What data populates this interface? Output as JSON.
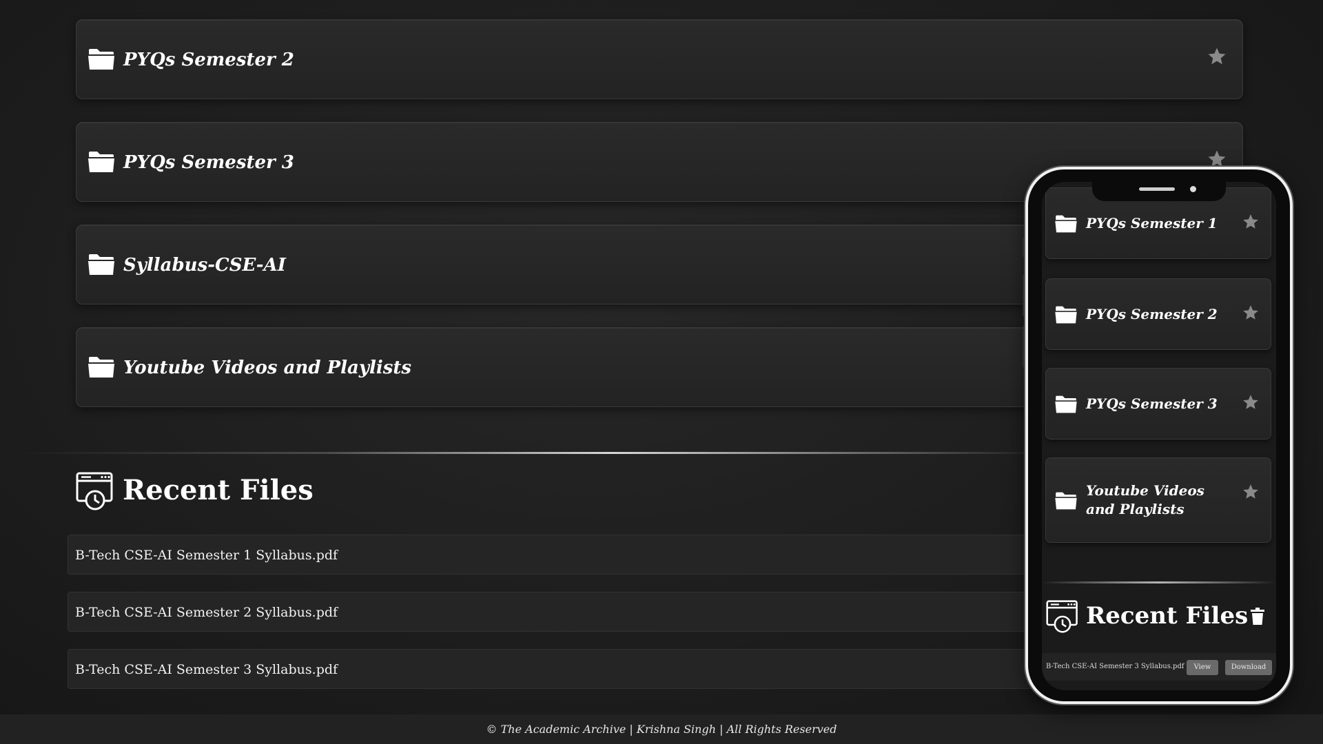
{
  "folders": [
    {
      "label": "PYQs Semester 2"
    },
    {
      "label": "PYQs Semester 3"
    },
    {
      "label": "Syllabus-CSE-AI"
    },
    {
      "label": "Youtube Videos and Playlists"
    }
  ],
  "recent": {
    "title": "Recent Files",
    "files": [
      "B-Tech CSE-AI Semester 1 Syllabus.pdf",
      "B-Tech CSE-AI Semester 2 Syllabus.pdf",
      "B-Tech CSE-AI Semester 3 Syllabus.pdf"
    ]
  },
  "footer": {
    "text": "© The Academic Archive | Krishna Singh | All Rights Reserved"
  },
  "mobile": {
    "folders": [
      {
        "label": "PYQs Semester 1"
      },
      {
        "label": "PYQs Semester 2"
      },
      {
        "label": "PYQs Semester 3"
      },
      {
        "label": "Youtube Videos and Playlists"
      }
    ],
    "recent_title": "Recent Files",
    "recent_file": "B-Tech CSE-AI Semester 3 Syllabus.pdf",
    "view_label": "View",
    "download_label": "Download"
  },
  "icons": {
    "folder": "folder-icon",
    "star": "star-icon",
    "recent": "recent-files-icon",
    "trash": "trash-icon"
  },
  "colors": {
    "background": "#1d1d1d",
    "card": "#262626",
    "text": "#ffffff",
    "star": "#8a8a8a"
  }
}
